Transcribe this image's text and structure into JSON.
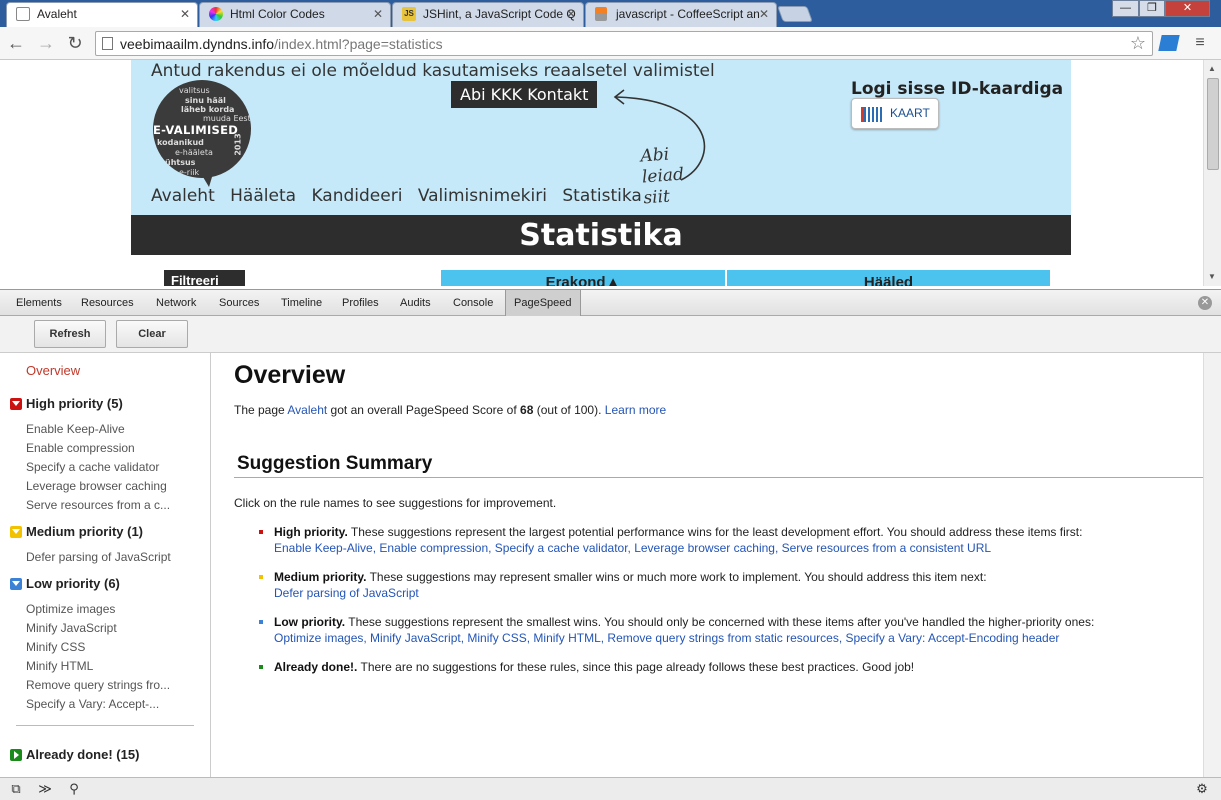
{
  "browser": {
    "tabs": [
      {
        "title": "Avaleht",
        "icon": "page-icon"
      },
      {
        "title": "Html Color Codes",
        "icon": "color-wheel-icon"
      },
      {
        "title": "JSHint, a JavaScript Code Q",
        "icon": "js-icon"
      },
      {
        "title": "javascript - CoffeeScript an",
        "icon": "stackoverflow-icon"
      }
    ],
    "url_host": "veebimaailm.dyndns.info",
    "url_path": "/index.html?page=statistics"
  },
  "site": {
    "disclaimer": "Antud rakendus ei ole mõeldud kasutamiseks reaalsetel valimistel",
    "help_menu": "Abi KKK Kontakt",
    "logo": {
      "main_text": "E-VALIMISED",
      "words": [
        "valitsus",
        "sinu hääl",
        "läheb korda",
        "muuda Eestit",
        "kodanikud",
        "e-hääleta",
        "ühtsus",
        "e-riik",
        "2013"
      ]
    },
    "nav": [
      "Avaleht",
      "Hääleta",
      "Kandideeri",
      "Valimisnimekiri",
      "Statistika"
    ],
    "handwriting": [
      "Abi",
      "leiad",
      "siit"
    ],
    "login_title": "Logi sisse ID-kaardiga",
    "login_button": "KAART",
    "page_heading": "Statistika",
    "filter_label": "Filtreeri",
    "table_headers": [
      "Erakond▲",
      "Hääled"
    ]
  },
  "devtools": {
    "tabs": [
      "Elements",
      "Resources",
      "Network",
      "Sources",
      "Timeline",
      "Profiles",
      "Audits",
      "Console",
      "PageSpeed"
    ],
    "active_tab": "PageSpeed",
    "refresh_label": "Refresh",
    "clear_label": "Clear"
  },
  "sidebar": {
    "overview": "Overview",
    "high": {
      "label": "High priority (5)",
      "color": "#cc1111",
      "items": [
        "Enable Keep-Alive",
        "Enable compression",
        "Specify a cache validator",
        "Leverage browser caching",
        "Serve resources from a c..."
      ]
    },
    "medium": {
      "label": "Medium priority (1)",
      "color": "#f2c200",
      "items": [
        "Defer parsing of JavaScript"
      ]
    },
    "low": {
      "label": "Low priority (6)",
      "color": "#3b82d6",
      "items": [
        "Optimize images",
        "Minify JavaScript",
        "Minify CSS",
        "Minify HTML",
        "Remove query strings fro...",
        "Specify a Vary: Accept-..."
      ]
    },
    "done": {
      "label": "Already done! (15)",
      "color": "#1a8a1a"
    }
  },
  "main": {
    "title": "Overview",
    "score_prefix": "The page",
    "score_page": "Avaleht",
    "score_middle": "got an overall PageSpeed Score of",
    "score_value": "68",
    "score_suffix": "(out of 100).",
    "learn_more": "Learn more",
    "summary_title": "Suggestion Summary",
    "intro": "Click on the rule names to see suggestions for improvement.",
    "high": {
      "label": "High priority.",
      "text": "These suggestions represent the largest potential performance wins for the least development effort. You should address these items first:",
      "links": "Enable Keep-Alive, Enable compression, Specify a cache validator, Leverage browser caching, Serve resources from a consistent URL"
    },
    "medium": {
      "label": "Medium priority.",
      "text": "These suggestions may represent smaller wins or much more work to implement. You should address this item next:",
      "links": "Defer parsing of JavaScript"
    },
    "low": {
      "label": "Low priority.",
      "text": "These suggestions represent the smallest wins. You should only be concerned with these items after you've handled the higher-priority ones:",
      "links": "Optimize images, Minify JavaScript, Minify CSS, Minify HTML, Remove query strings from static resources, Specify a Vary: Accept-Encoding header"
    },
    "done": {
      "label": "Already done!.",
      "text": "There are no suggestions for these rules, since this page already follows these best practices. Good job!"
    }
  }
}
